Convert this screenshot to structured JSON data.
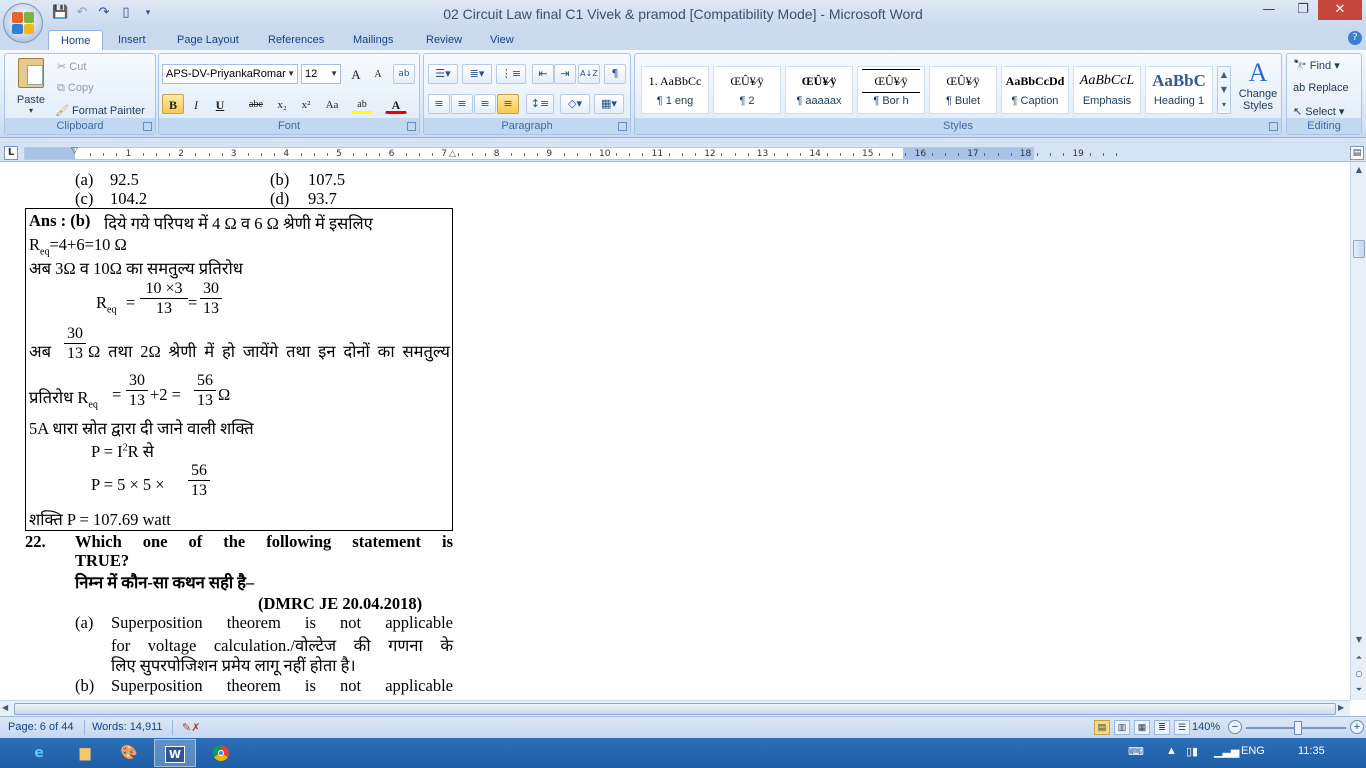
{
  "window": {
    "title": "02 Circuit Law final C1 Vivek & pramod [Compatibility Mode] - Microsoft Word",
    "minimize": "—",
    "restore": "❐",
    "close": "✕"
  },
  "tabs": [
    "Home",
    "Insert",
    "Page Layout",
    "References",
    "Mailings",
    "Review",
    "View"
  ],
  "help_icon": "?",
  "ribbon": {
    "clipboard": {
      "label": "Clipboard",
      "paste": "Paste",
      "cut": "Cut",
      "copy": "Copy",
      "format_painter": "Format Painter"
    },
    "font": {
      "label": "Font",
      "font_name": "APS-DV-PriyankaRomar",
      "font_size": "12",
      "grow": "A",
      "shrink": "A",
      "clear": "ab",
      "bold": "B",
      "italic": "I",
      "underline": "U",
      "strike": "abe",
      "subscript": "x₂",
      "superscript": "x²",
      "change_case": "Aa",
      "highlight": "ab",
      "font_color": "A"
    },
    "paragraph": {
      "label": "Paragraph",
      "sort": "A↓Z",
      "pilcrow": "¶"
    },
    "styles": {
      "label": "Styles",
      "tiles": [
        {
          "sample": "1. AaBbCc",
          "name": "¶ 1 eng"
        },
        {
          "sample": "ŒÛ¥⁄ÿ",
          "name": "¶ 2"
        },
        {
          "sample": "ŒÛ¥⁄ÿ",
          "name": "¶ aaaaax"
        },
        {
          "sample": "ŒÛ¥⁄ÿ",
          "name": "¶ Bor h"
        },
        {
          "sample": "ŒÛ¥⁄ÿ",
          "name": "¶ Bulet"
        },
        {
          "sample": "AaBbCcDd",
          "name": "¶ Caption"
        },
        {
          "sample": "AaBbCcL",
          "name": "Emphasis"
        },
        {
          "sample": "AaBbC",
          "name": "Heading 1"
        }
      ],
      "change_styles": "Change Styles"
    },
    "editing": {
      "label": "Editing",
      "find": "Find",
      "replace": "Replace",
      "select": "Select"
    }
  },
  "ruler": {
    "tab_marker": "L",
    "numbers": [
      "1",
      "2",
      "3",
      "4",
      "5",
      "6",
      "7",
      "8",
      "9",
      "10",
      "11",
      "12",
      "13",
      "14",
      "15",
      "16",
      "17",
      "18",
      "19"
    ]
  },
  "document": {
    "opt_a_label": "(a)",
    "opt_a_val": "92.5",
    "opt_b_label": "(b)",
    "opt_b_val": "107.5",
    "opt_c_label": "(c)",
    "opt_c_val": "104.2",
    "opt_d_label": "(d)",
    "opt_d_val": "93.7",
    "ans_bold": "Ans : (b)",
    "ans_line1": "दिये गये परिपथ में 4 Ω व 6 Ω श्रेणी में इसलिए",
    "req_R": "R",
    "req_sub": "eq",
    "req_rest": "=4+6=10 Ω",
    "line3": "अब    3Ω  व  10Ω  का समतुल्य प्रतिरोध",
    "eq1_lhs": "R",
    "eq1_sub": "eq",
    "eq1_eq": "=",
    "eq1_num1": "10 ×3",
    "eq1_den1": "13",
    "eq1_eq2": "=",
    "eq1_num2": "30",
    "eq1_den2": "13",
    "line5_ab": "अब",
    "line5_num": "30",
    "line5_den": "13",
    "line5_rest": "Ω  तथा  2Ω  श्रेणी  में  हो  जायेंगे  तथा  इन  दोनों  का  समतुल्य",
    "line6_label": "प्रतिरोध  R",
    "line6_sub": "eq",
    "line6_eq": "=",
    "line6_num1": "30",
    "line6_den1": "13",
    "line6_plus": "+2 =",
    "line6_num2": "56",
    "line6_den2": "13",
    "line6_omega": "Ω",
    "line7": "5A धारा स्रोत द्वारा दी जाने वाली शक्ति",
    "line8_a": "P = I",
    "line8_sup": "2",
    "line8_b": "R से",
    "line9": "P = 5 × 5 ×",
    "line9_num": "56",
    "line9_den": "13",
    "line10": "शक्ति P = 107.69 watt",
    "q_num": "22.",
    "q_line1": "Which  one  of  the  following  statement  is",
    "q_line2": "TRUE?",
    "q_hindi": "निम्न में कौन-सा कथन सही है–",
    "q_source": "(DMRC JE 20.04.2018)",
    "qa_label": "(a)",
    "qa_line1": "Superposition  theorem  is  not  applicable",
    "qa_line2": "for  voltage  calculation./वोल्टेज  की  गणना  के",
    "qa_line3": "लिए सुपरपोजिशन प्रमेय लागू नहीं होता है।",
    "qb_label": "(b)",
    "qb_line1": "Superposition  theorem  is  not  applicable"
  },
  "status": {
    "page": "Page: 6 of 44",
    "words": "Words: 14,911",
    "zoom": "140%"
  },
  "taskbar": {
    "lang": "ENG",
    "time": "11:35"
  },
  "colors": {
    "ribbon_blue": "#c9d9ee",
    "close_red": "#c7463b",
    "taskbar_blue": "#1e5fa8"
  }
}
